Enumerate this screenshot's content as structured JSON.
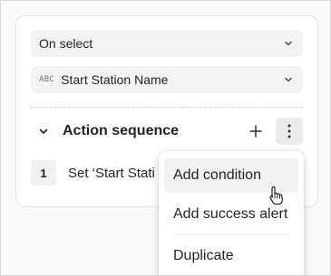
{
  "trigger_select": {
    "value": "On select"
  },
  "field_select": {
    "type_badge": "ABC",
    "value": "Start Station Name"
  },
  "action_sequence": {
    "title": "Action sequence",
    "steps": [
      {
        "number": "1",
        "label": "Set ‘Start Stati"
      }
    ]
  },
  "context_menu": {
    "items": [
      {
        "label": "Add condition"
      },
      {
        "label": "Add success alert"
      },
      {
        "label": "Duplicate"
      }
    ]
  },
  "icons": {
    "collapse": "chevron-down-icon",
    "add": "plus-icon",
    "more": "kebab-icon",
    "cursor": "hand-pointer-icon"
  }
}
